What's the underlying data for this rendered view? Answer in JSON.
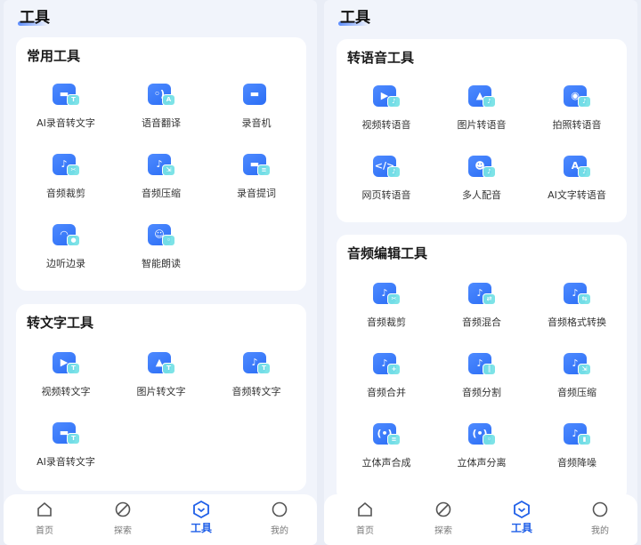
{
  "left": {
    "title": "工具",
    "sections": [
      {
        "title": "常用工具",
        "items": [
          {
            "label": "AI录音转文字",
            "icon": "ai-record-to-text-icon",
            "sym": "▬",
            "badge": "T"
          },
          {
            "label": "语音翻译",
            "icon": "voice-translate-icon",
            "sym": "◦)",
            "badge": "A"
          },
          {
            "label": "录音机",
            "icon": "recorder-icon",
            "sym": "▬",
            "badge": ""
          },
          {
            "label": "音频裁剪",
            "icon": "audio-trim-icon",
            "sym": "♪",
            "badge": "✂"
          },
          {
            "label": "音频压缩",
            "icon": "audio-compress-icon",
            "sym": "♪",
            "badge": "⇲"
          },
          {
            "label": "录音提词",
            "icon": "prompter-icon",
            "sym": "▬",
            "badge": "≡"
          },
          {
            "label": "边听边录",
            "icon": "listen-record-icon",
            "sym": "◠",
            "badge": "●"
          },
          {
            "label": "智能朗读",
            "icon": "smart-read-icon",
            "sym": "☺",
            "badge": "◦"
          }
        ]
      },
      {
        "title": "转文字工具",
        "items": [
          {
            "label": "视频转文字",
            "icon": "video-to-text-icon",
            "sym": "▶",
            "badge": "T"
          },
          {
            "label": "图片转文字",
            "icon": "image-to-text-icon",
            "sym": "▲",
            "badge": "T"
          },
          {
            "label": "音频转文字",
            "icon": "audio-to-text-icon",
            "sym": "♪",
            "badge": "T"
          },
          {
            "label": "AI录音转文字",
            "icon": "ai-record-to-text-icon",
            "sym": "▬",
            "badge": "T"
          }
        ]
      }
    ],
    "tabs": [
      {
        "label": "首页",
        "icon": "home-icon"
      },
      {
        "label": "探索",
        "icon": "explore-icon"
      },
      {
        "label": "工具",
        "icon": "tools-icon"
      },
      {
        "label": "我的",
        "icon": "profile-icon"
      }
    ]
  },
  "right": {
    "title": "工具",
    "sections": [
      {
        "title": "转语音工具",
        "items": [
          {
            "label": "视频转语音",
            "icon": "video-to-voice-icon",
            "sym": "▶",
            "badge": "♪"
          },
          {
            "label": "图片转语音",
            "icon": "image-to-voice-icon",
            "sym": "▲",
            "badge": "♪"
          },
          {
            "label": "拍照转语音",
            "icon": "photo-to-voice-icon",
            "sym": "◉",
            "badge": "♪"
          },
          {
            "label": "网页转语音",
            "icon": "web-to-voice-icon",
            "sym": "</>",
            "badge": "♪"
          },
          {
            "label": "多人配音",
            "icon": "multi-dub-icon",
            "sym": "☻",
            "badge": "♪"
          },
          {
            "label": "AI文字转语音",
            "icon": "ai-text-to-voice-icon",
            "sym": "A",
            "badge": "♪"
          }
        ]
      },
      {
        "title": "音频编辑工具",
        "items": [
          {
            "label": "音频裁剪",
            "icon": "audio-trim-icon",
            "sym": "♪",
            "badge": "✂"
          },
          {
            "label": "音频混合",
            "icon": "audio-mix-icon",
            "sym": "♪",
            "badge": "⇄"
          },
          {
            "label": "音频格式转换",
            "icon": "audio-format-icon",
            "sym": "♪",
            "badge": "⇆"
          },
          {
            "label": "音频合并",
            "icon": "audio-merge-icon",
            "sym": "♪",
            "badge": "+"
          },
          {
            "label": "音频分割",
            "icon": "audio-split-icon",
            "sym": "♪",
            "badge": "║"
          },
          {
            "label": "音频压缩",
            "icon": "audio-compress-icon",
            "sym": "♪",
            "badge": "⇲"
          },
          {
            "label": "立体声合成",
            "icon": "stereo-merge-icon",
            "sym": "(•)",
            "badge": "≡"
          },
          {
            "label": "立体声分离",
            "icon": "stereo-split-icon",
            "sym": "(•)",
            "badge": "◦"
          },
          {
            "label": "音频降噪",
            "icon": "denoise-icon",
            "sym": "♪",
            "badge": "▮"
          }
        ]
      }
    ],
    "tabs": [
      {
        "label": "首页",
        "icon": "home-icon"
      },
      {
        "label": "探索",
        "icon": "explore-icon"
      },
      {
        "label": "工具",
        "icon": "tools-icon"
      },
      {
        "label": "我的",
        "icon": "profile-icon"
      }
    ]
  },
  "active_tab": "工具",
  "colors": {
    "accent": "#1f5fe8",
    "icon": "#2f74f8",
    "badge": "#76e2e6"
  }
}
